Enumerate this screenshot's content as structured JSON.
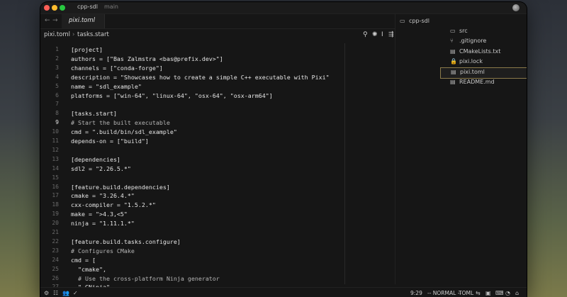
{
  "window": {
    "project": "cpp-sdl",
    "branch": "main"
  },
  "nav": {
    "back": "←",
    "forward": "→"
  },
  "tab": {
    "label": "pixi.toml"
  },
  "breadcrumbs": {
    "file": "pixi.toml",
    "separator": "›",
    "section": "tasks.start"
  },
  "toolbar": {
    "search_icon": "⚲",
    "tools_icon": "✺",
    "cursor_icon": "I",
    "sliders_icon": "⇶"
  },
  "editor": {
    "active_line": "9",
    "lines": [
      {
        "n": "1",
        "text": "[project]"
      },
      {
        "n": "2",
        "text": "authors = [\"Bas Zalmstra <bas@prefix.dev>\"]"
      },
      {
        "n": "3",
        "text": "channels = [\"conda-forge\"]"
      },
      {
        "n": "4",
        "text": "description = \"Showcases how to create a simple C++ executable with Pixi\""
      },
      {
        "n": "5",
        "text": "name = \"sdl_example\""
      },
      {
        "n": "6",
        "text": "platforms = [\"win-64\", \"linux-64\", \"osx-64\", \"osx-arm64\"]"
      },
      {
        "n": "7",
        "text": ""
      },
      {
        "n": "8",
        "text": "[tasks.start]"
      },
      {
        "n": "9",
        "text": "# Start the built executable"
      },
      {
        "n": "10",
        "text": "cmd = \".build/bin/sdl_example\""
      },
      {
        "n": "11",
        "text": "depends-on = [\"build\"]"
      },
      {
        "n": "12",
        "text": ""
      },
      {
        "n": "13",
        "text": "[dependencies]"
      },
      {
        "n": "14",
        "text": "sdl2 = \"2.26.5.*\""
      },
      {
        "n": "15",
        "text": ""
      },
      {
        "n": "16",
        "text": "[feature.build.dependencies]"
      },
      {
        "n": "17",
        "text": "cmake = \"3.26.4.*\""
      },
      {
        "n": "18",
        "text": "cxx-compiler = \"1.5.2.*\""
      },
      {
        "n": "19",
        "text": "make = \">4.3,<5\""
      },
      {
        "n": "20",
        "text": "ninja = \"1.11.1.*\""
      },
      {
        "n": "21",
        "text": ""
      },
      {
        "n": "22",
        "text": "[feature.build.tasks.configure]"
      },
      {
        "n": "23",
        "text": "# Configures CMake"
      },
      {
        "n": "24",
        "text": "cmd = ["
      },
      {
        "n": "25",
        "text": "  \"cmake\","
      },
      {
        "n": "26",
        "text": "  # Use the cross-platform Ninja generator"
      },
      {
        "n": "27",
        "text": "  \"-GNinja\","
      }
    ]
  },
  "sidebar": {
    "root": {
      "icon": "▭",
      "label": "cpp-sdl"
    },
    "items": [
      {
        "icon": "▭",
        "label": "src"
      },
      {
        "icon": "⑂",
        "label": ".gitignore"
      },
      {
        "icon": "▤",
        "label": "CMakeLists.txt"
      },
      {
        "icon": "🔒",
        "label": "pixi.lock"
      },
      {
        "icon": "▤",
        "label": "pixi.toml"
      },
      {
        "icon": "▤",
        "label": "README.md"
      }
    ]
  },
  "statusbar": {
    "left_icons": [
      "⚙",
      "☷",
      "👥",
      "✓"
    ],
    "position": "9:29",
    "mode": "-- NORMAL --",
    "language": "TOML",
    "right_icons": [
      "⇆",
      "▣",
      "⌨",
      "◔",
      "⌂"
    ]
  },
  "colors": {
    "background": "#161616",
    "selected_border": "#8a7a4a",
    "string": "#c8e6a8"
  }
}
